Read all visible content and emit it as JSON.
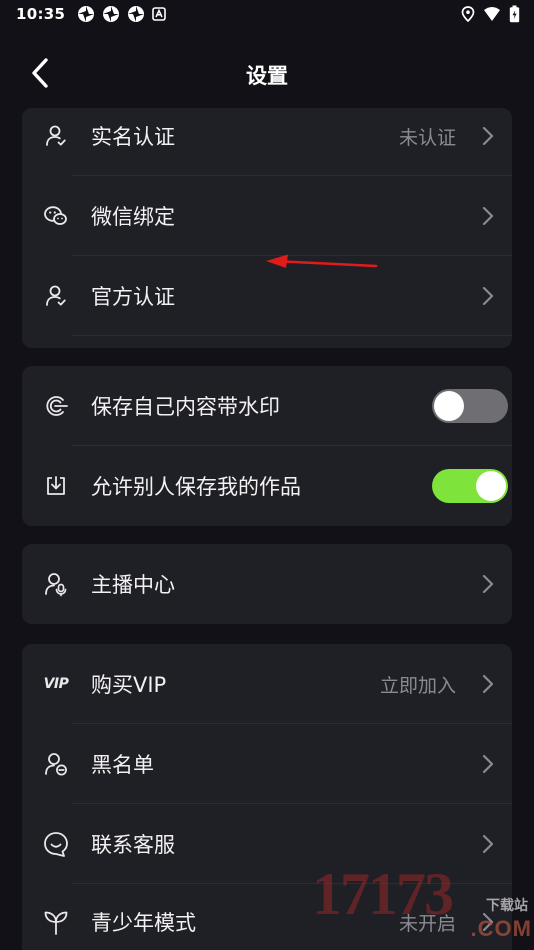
{
  "status_bar": {
    "time": "10:35"
  },
  "header": {
    "title": "设置"
  },
  "account_card": {
    "items": [
      {
        "label": "实名认证",
        "value": "未认证",
        "icon": "user-icon"
      },
      {
        "label": "微信绑定",
        "value": "",
        "icon": "wechat-icon"
      },
      {
        "label": "官方认证",
        "value": "",
        "icon": "user-check-icon"
      }
    ]
  },
  "privacy_card": {
    "items": [
      {
        "label": "保存自己内容带水印",
        "toggle": "off",
        "icon": "watermark-icon"
      },
      {
        "label": "允许别人保存我的作品",
        "toggle": "on",
        "icon": "download-icon"
      }
    ]
  },
  "creator_card": {
    "items": [
      {
        "label": "主播中心",
        "icon": "anchor-icon"
      }
    ]
  },
  "more_card": {
    "items": [
      {
        "label": "购买VIP",
        "value": "立即加入",
        "icon": "vip-icon"
      },
      {
        "label": "黑名单",
        "value": "",
        "icon": "blacklist-icon"
      },
      {
        "label": "联系客服",
        "value": "",
        "icon": "service-icon"
      },
      {
        "label": "青少年模式",
        "value": "未开启",
        "icon": "sprout-icon"
      }
    ],
    "vip_icon_text": "VIP"
  },
  "watermark": {
    "number": "17173",
    "domain": ".COM",
    "tag": "下载站"
  },
  "colors": {
    "background": "#121117",
    "card": "#1f1f26",
    "toggle_on": "#7ee33a",
    "toggle_off": "#6e6e73",
    "annotation_arrow": "#e01b1b"
  }
}
